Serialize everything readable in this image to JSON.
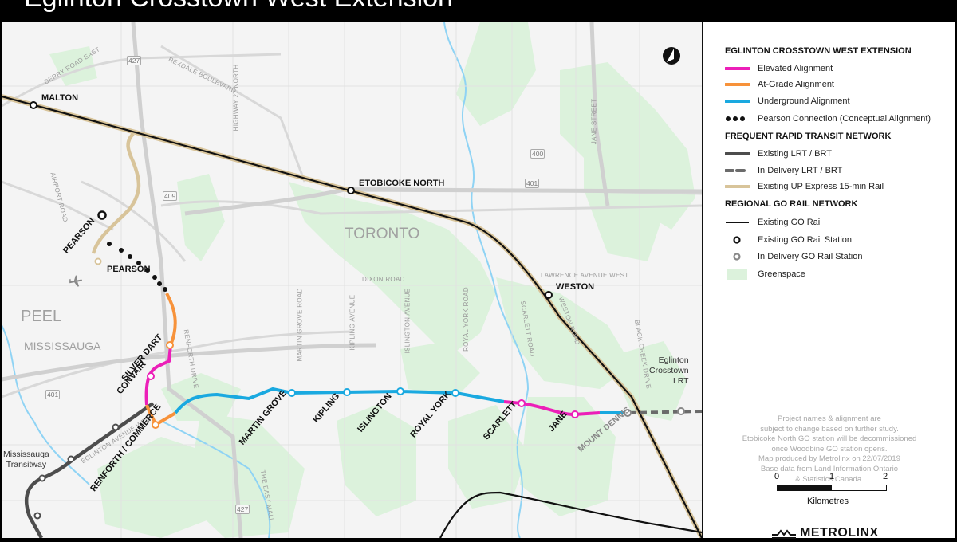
{
  "title": "Eglinton Crosstown West Extension",
  "colors": {
    "elevated": "#ec1fb8",
    "at_grade": "#f7923a",
    "underground": "#1aa9e0",
    "existing_lrt": "#4d4d4d",
    "in_delivery_lrt": "#6b6b6b",
    "up_express": "#d8c49a",
    "go_rail": "#111111",
    "greenspace": "#dcf2dc",
    "water": "#8fd3f4"
  },
  "map": {
    "regions": {
      "peel": "PEEL",
      "mississauga": "MISSISSAUGA",
      "toronto": "TORONTO"
    },
    "roads": {
      "derry_road_east": "DERRY ROAD EAST",
      "rexdale_boulevard": "REXDALE BOULEVARD",
      "highway_27_north": "HIGHWAY 27 NORTH",
      "airport_road": "AIRPORT ROAD",
      "jane_street": "JANE STREET",
      "dixon_road": "DIXON ROAD",
      "lawrence_avenue_west": "LAWRENCE AVENUE WEST",
      "renforth_drive": "RENFORTH DRIVE",
      "martin_grove_road": "MARTIN GROVE ROAD",
      "kipling_avenue": "KIPLING AVENUE",
      "islington_avenue": "ISLINGTON AVENUE",
      "royal_york_road": "ROYAL YORK ROAD",
      "scarlett_road": "SCARLETT ROAD",
      "weston_road": "WESTON ROAD",
      "black_creek_drive": "BLACK CREEK DRIVE",
      "eglinton_avenue_west": "EGLINTON AVENUE WEST",
      "the_east_mall": "THE EAST MALL"
    },
    "highway_shields": {
      "h427_north": "427",
      "h409": "409",
      "h400": "400",
      "h401_east": "401",
      "h401_west": "401",
      "h427_south": "427"
    },
    "go_stations": {
      "malton": "MALTON",
      "etobicoke_north": "ETOBICOKE NORTH",
      "weston": "WESTON"
    },
    "up_station": "PEARSON",
    "ecwe_stations": {
      "pearson": "PEARSON",
      "silver_dart": "SILVER DART",
      "convair": "CONVAIR",
      "renforth_commerce": "RENFORTH / COMMERCE",
      "martin_grove": "MARTIN GROVE",
      "kipling": "KIPLING",
      "islington": "ISLINGTON",
      "royal_york": "ROYAL YORK",
      "scarlett": "SCARLETT",
      "jane": "JANE",
      "mount_dennis": "MOUNT DENNIS"
    },
    "line_labels": {
      "mississauga_transitway": [
        "Mississauga",
        "Transitway"
      ],
      "eglinton_crosstown_lrt": [
        "Eglinton",
        "Crosstown",
        "LRT"
      ]
    },
    "icons": {
      "north_arrow": "north-arrow-icon",
      "airport": "airplane-icon"
    }
  },
  "legend": {
    "sections": [
      {
        "heading": "EGLINTON CROSSTOWN WEST EXTENSION",
        "items": [
          {
            "label": "Elevated Alignment",
            "symbol": "line-elevated"
          },
          {
            "label": "At-Grade Alignment",
            "symbol": "line-at-grade"
          },
          {
            "label": "Underground Alignment",
            "symbol": "line-underground"
          },
          {
            "label": "Pearson Connection (Conceptual Alignment)",
            "symbol": "dots"
          }
        ]
      },
      {
        "heading": "FREQUENT RAPID TRANSIT NETWORK",
        "items": [
          {
            "label": "Existing LRT / BRT",
            "symbol": "line-existing-lrt"
          },
          {
            "label": "In Delivery LRT / BRT",
            "symbol": "dash-in-delivery"
          },
          {
            "label": "Existing UP Express 15-min Rail",
            "symbol": "line-up-express"
          }
        ]
      },
      {
        "heading": "REGIONAL GO RAIL NETWORK",
        "items": [
          {
            "label": "Existing GO Rail",
            "symbol": "line-go"
          },
          {
            "label": "Existing GO Rail Station",
            "symbol": "station-existing"
          },
          {
            "label": "In Delivery GO Rail Station",
            "symbol": "station-in-delivery"
          },
          {
            "label": "Greenspace",
            "symbol": "greenspace"
          }
        ]
      }
    ],
    "notes": [
      "Project names & alignment are",
      "subject to change based on further study.",
      "Etobicoke North GO station will be decommissioned",
      "once Woodbine GO station opens.",
      "Map produced by Metrolinx on 22/07/2019",
      "Base data from Land Information Ontario",
      "& Statistics Canada."
    ],
    "scale": {
      "ticks": [
        "0",
        "1",
        "2"
      ],
      "unit": "Kilometres"
    },
    "logo": "METROLINX"
  }
}
